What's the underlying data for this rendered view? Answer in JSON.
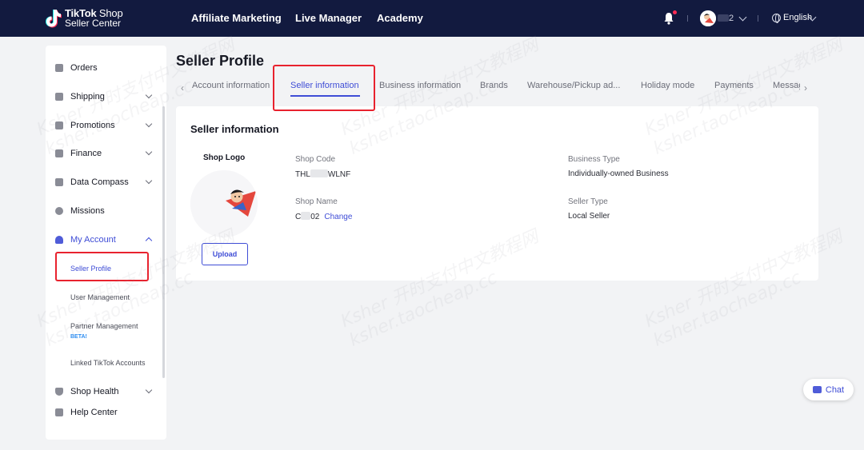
{
  "topbar": {
    "logo_line1_bold": "TikTok",
    "logo_line1_light": " Shop",
    "logo_line2": "Seller Center",
    "nav": [
      "Affiliate Marketing",
      "Live Manager",
      "Academy"
    ],
    "user_name_suffix": "2",
    "language": "English"
  },
  "sidebar": {
    "items": [
      {
        "label": "Orders",
        "icon": "orders-icon"
      },
      {
        "label": "Shipping",
        "icon": "shipping-icon"
      },
      {
        "label": "Promotions",
        "icon": "megaphone-icon"
      },
      {
        "label": "Finance",
        "icon": "card-icon"
      },
      {
        "label": "Data Compass",
        "icon": "bar-chart-icon"
      },
      {
        "label": "Missions",
        "icon": "medal-icon"
      },
      {
        "label": "My Account",
        "icon": "user-icon"
      }
    ],
    "sub_items": [
      "Seller Profile",
      "User Management",
      "Partner Management",
      "Linked TikTok Accounts"
    ],
    "beta_badge": "BETA!",
    "bottom_items": [
      {
        "label": "Shop Health",
        "icon": "trophy-icon"
      },
      {
        "label": "Help Center",
        "icon": "help-icon"
      }
    ]
  },
  "main": {
    "page_title": "Seller Profile",
    "tabs": [
      "Account information",
      "Seller information",
      "Business information",
      "Brands",
      "Warehouse/Pickup ad...",
      "Holiday mode",
      "Payments",
      "Messag"
    ],
    "active_tab": "Seller information",
    "card": {
      "title": "Seller information",
      "logo_label": "Shop Logo",
      "upload_label": "Upload",
      "shop_code_label": "Shop Code",
      "shop_code_prefix": "THL",
      "shop_code_suffix": "WLNF",
      "shop_name_label": "Shop Name",
      "shop_name_prefix": "C",
      "shop_name_suffix": "02",
      "change_label": "Change",
      "business_type_label": "Business Type",
      "business_type_value": "Individually-owned Business",
      "seller_type_label": "Seller Type",
      "seller_type_value": "Local Seller"
    }
  },
  "chat": {
    "label": "Chat"
  },
  "watermark": {
    "line1": "Ksher 开时支付中文教程网",
    "line2": "ksher.taocheap.cc"
  },
  "colors": {
    "topbar": "#121a3f",
    "accent": "#3f4dd6",
    "highlight": "#e8222e"
  }
}
